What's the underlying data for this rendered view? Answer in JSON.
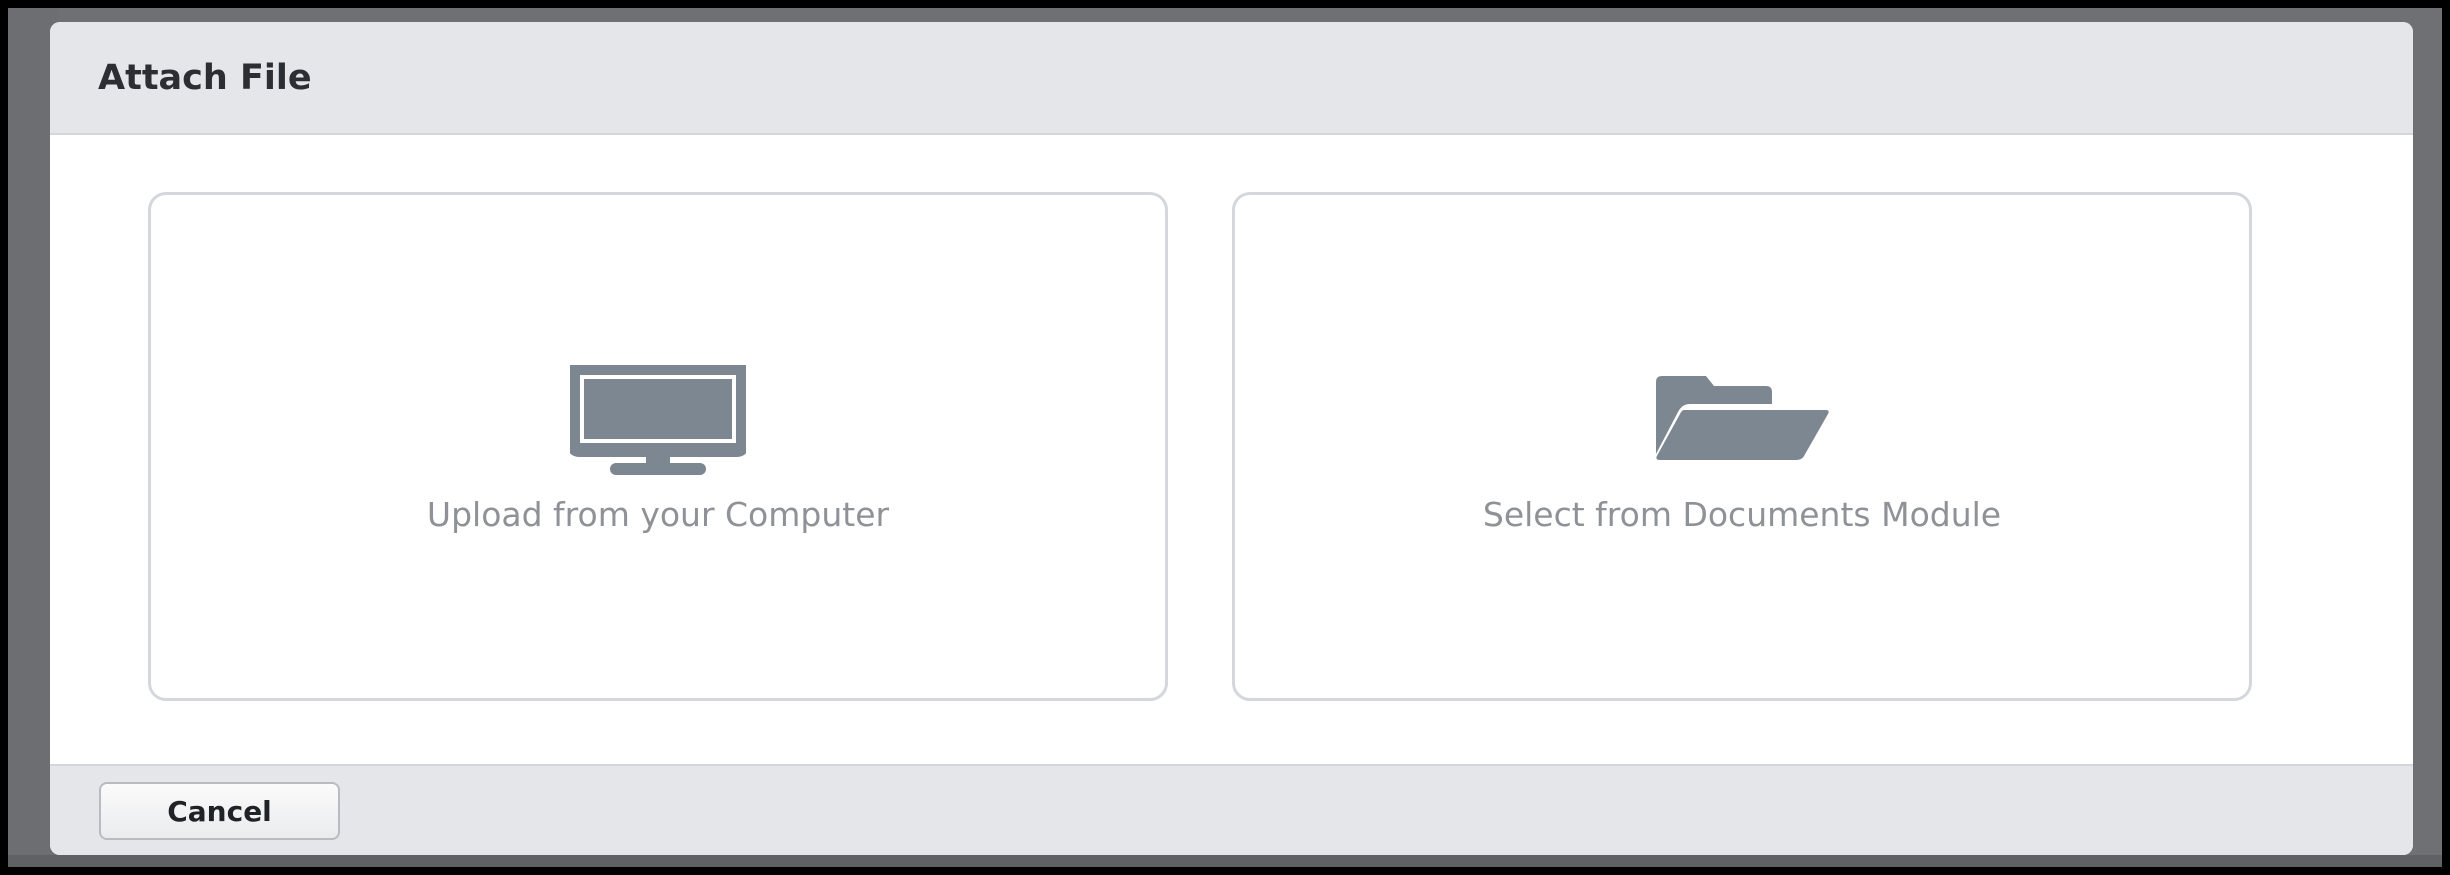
{
  "modal": {
    "title": "Attach File",
    "options": [
      {
        "label": "Upload from your Computer",
        "icon": "monitor-icon"
      },
      {
        "label": "Select from Documents Module",
        "icon": "folder-open-icon"
      }
    ],
    "cancel_label": "Cancel"
  },
  "colors": {
    "icon": "#7d8792",
    "header_bg": "#e4e6ea",
    "card_border": "#d4d7db",
    "label_text": "#8e9297"
  }
}
